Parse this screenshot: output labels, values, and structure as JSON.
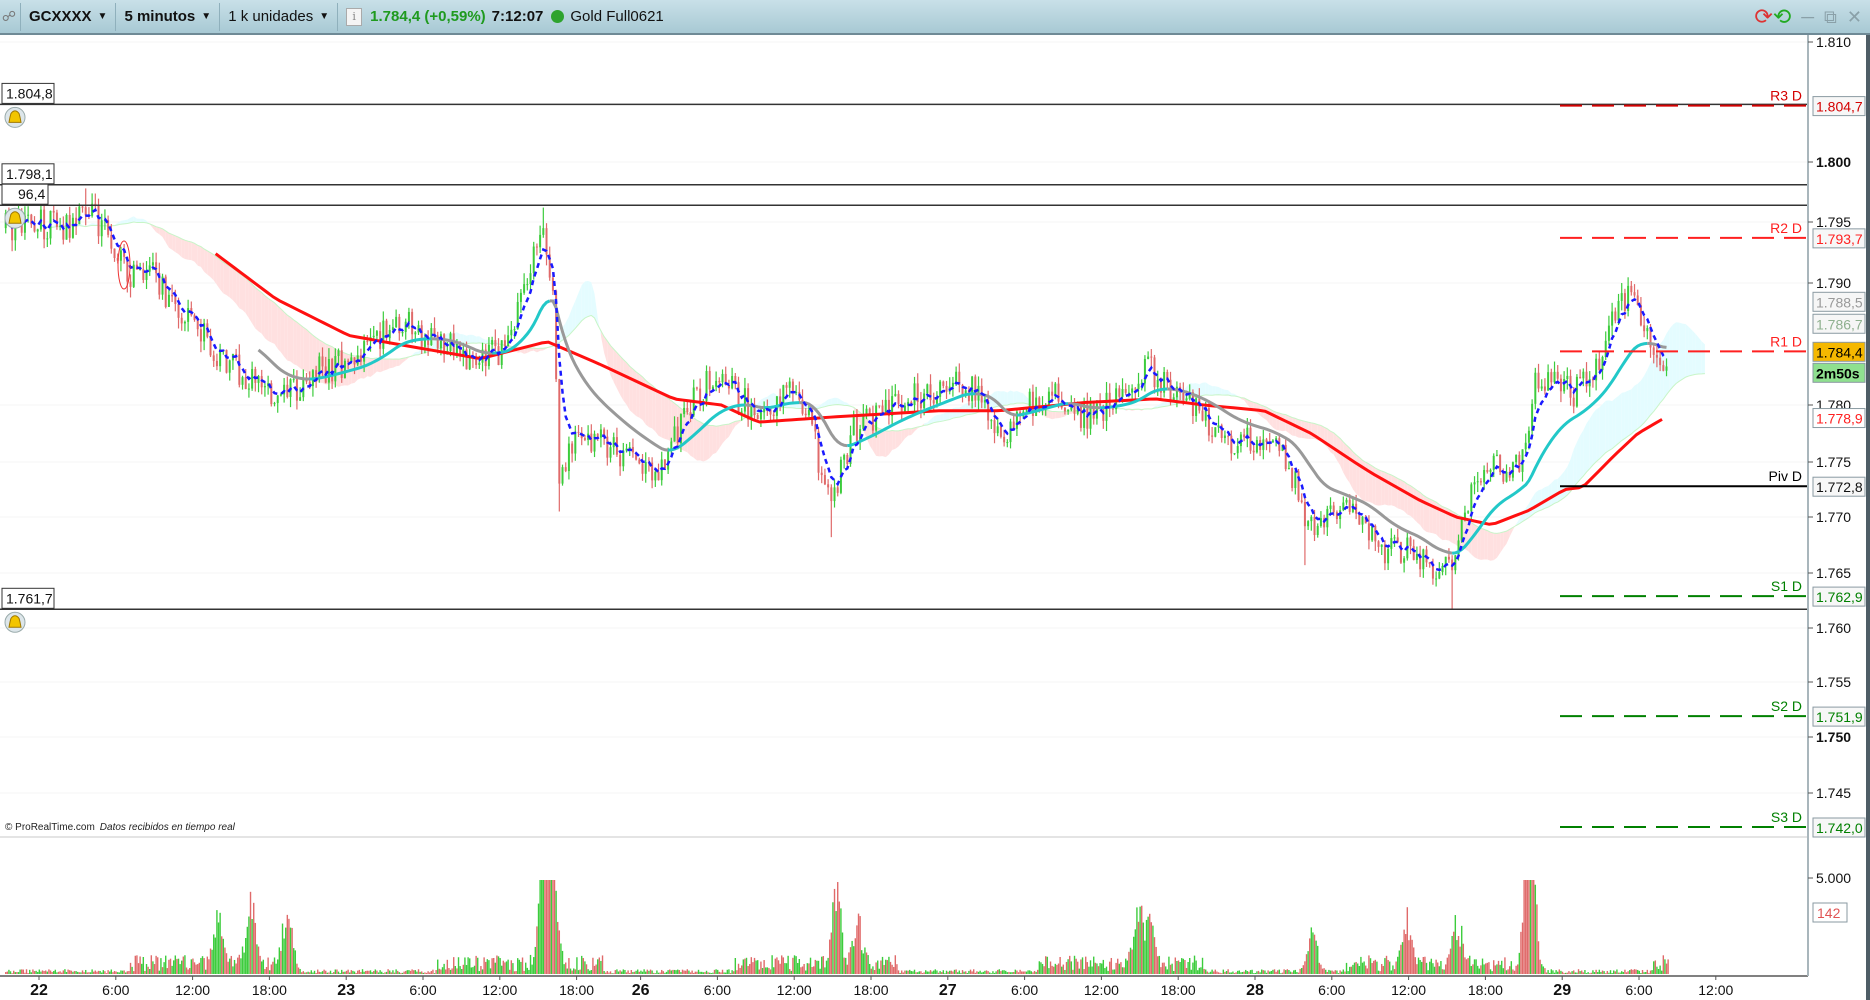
{
  "toolbar": {
    "symbol": "GCXXXX",
    "timeframe": "5 minutos",
    "units": "1 k unidades",
    "last_price": "1.784,4 (+0,59%)",
    "time": "7:12:07",
    "instrument_name": "Gold Full0621",
    "status_color": "#2ea32e"
  },
  "footer": {
    "copyright": "© ProRealTime.com",
    "realtime_note": "Datos recibidos en tiempo real"
  },
  "alerts": [
    {
      "label": "1.804,8",
      "price": 1.8048,
      "bell": true
    },
    {
      "label": "1.798,1",
      "price": 1.7981,
      "bell": false
    },
    {
      "label": "96,4",
      "price": 1.7964,
      "bell": true
    },
    {
      "label": "1.761,7",
      "price": 1.7617,
      "bell": true
    }
  ],
  "pivots": [
    {
      "name": "R3 D",
      "value": "1.804,7",
      "price": 1.8047,
      "color": "#d40000",
      "style": "dashed"
    },
    {
      "name": "R2 D",
      "value": "1.793,7",
      "price": 1.7937,
      "color": "#ff2020",
      "style": "dashed"
    },
    {
      "name": "R1 D",
      "value": "1.784,4",
      "price": 1.7844,
      "color": "#ff2020",
      "style": "dashed",
      "hide_box": true
    },
    {
      "name": "Piv D",
      "value": "1.772,8",
      "price": 1.7728,
      "color": "#000000",
      "style": "solid"
    },
    {
      "name": "S1 D",
      "value": "1.762,9",
      "price": 1.7629,
      "color": "#008000",
      "style": "dashed"
    },
    {
      "name": "S2 D",
      "value": "1.751,9",
      "price": 1.7519,
      "color": "#008000",
      "style": "dashed"
    },
    {
      "name": "S3 D",
      "value": "1.742,0",
      "price": 1.742,
      "color": "#008000",
      "style": "dashed"
    }
  ],
  "price_boxes": [
    {
      "label": "1.788,5",
      "price": 1.7885,
      "color": "#999999",
      "bg": "#f6f6f6"
    },
    {
      "label": "1.786,7",
      "price": 1.7867,
      "color": "#8fb08f",
      "bg": "#f6f6f6"
    },
    {
      "label": "1.784,4",
      "price": 1.7844,
      "color": "#000000",
      "bg": "#f5b800"
    },
    {
      "label": "2m50s",
      "price": 1.783,
      "color": "#000000",
      "bg": "#8fe08f",
      "bold": true
    },
    {
      "label": "1.778,9",
      "price": 1.7789,
      "color": "#ff2020",
      "bg": "#ffffff"
    }
  ],
  "chart_data": {
    "type": "candlestick",
    "symbol": "GCXXXX",
    "interval": "5 minutos",
    "y_ticks": [
      {
        "value": 1.81,
        "label": "1.810"
      },
      {
        "value": 1.8,
        "label": "1.800",
        "bold": true
      },
      {
        "value": 1.795,
        "label": "1.795"
      },
      {
        "value": 1.79,
        "label": "1.790"
      },
      {
        "value": 1.78,
        "label": "1.780"
      },
      {
        "value": 1.775,
        "label": "1.775"
      },
      {
        "value": 1.77,
        "label": "1.770"
      },
      {
        "value": 1.765,
        "label": "1.765"
      },
      {
        "value": 1.76,
        "label": "1.760"
      },
      {
        "value": 1.755,
        "label": "1.755"
      },
      {
        "value": 1.75,
        "label": "1.750",
        "bold": true
      },
      {
        "value": 1.745,
        "label": "1.745"
      }
    ],
    "x_ticks": [
      {
        "t": 0,
        "label": "22",
        "bold": true
      },
      {
        "t": 6,
        "label": "6:00"
      },
      {
        "t": 12,
        "label": "12:00"
      },
      {
        "t": 18,
        "label": "18:00"
      },
      {
        "t": 24,
        "label": "23",
        "bold": true
      },
      {
        "t": 30,
        "label": "6:00"
      },
      {
        "t": 36,
        "label": "12:00"
      },
      {
        "t": 42,
        "label": "18:00"
      },
      {
        "t": 47,
        "label": "26",
        "bold": true
      },
      {
        "t": 53,
        "label": "6:00"
      },
      {
        "t": 59,
        "label": "12:00"
      },
      {
        "t": 65,
        "label": "18:00"
      },
      {
        "t": 71,
        "label": "27",
        "bold": true
      },
      {
        "t": 77,
        "label": "6:00"
      },
      {
        "t": 83,
        "label": "12:00"
      },
      {
        "t": 89,
        "label": "18:00"
      },
      {
        "t": 95,
        "label": "28",
        "bold": true
      },
      {
        "t": 101,
        "label": "6:00"
      },
      {
        "t": 107,
        "label": "12:00"
      },
      {
        "t": 113,
        "label": "18:00"
      },
      {
        "t": 119,
        "label": "29",
        "bold": true
      },
      {
        "t": 125,
        "label": "6:00"
      },
      {
        "t": 131,
        "label": "12:00"
      }
    ],
    "day_starts": [
      0,
      24,
      47,
      71,
      95,
      119
    ],
    "price_path": [
      [
        -2.6,
        1.7945
      ],
      [
        -0.3,
        1.795
      ],
      [
        2.5,
        1.7945
      ],
      [
        3.7,
        1.7965
      ],
      [
        5.4,
        1.794
      ],
      [
        6.8,
        1.791
      ],
      [
        9.1,
        1.7905
      ],
      [
        11.5,
        1.787
      ],
      [
        13.4,
        1.785
      ],
      [
        15.2,
        1.783
      ],
      [
        17.1,
        1.782
      ],
      [
        18.5,
        1.78
      ],
      [
        20.4,
        1.7815
      ],
      [
        22.3,
        1.783
      ],
      [
        25.1,
        1.784
      ],
      [
        27.9,
        1.787
      ],
      [
        29.4,
        1.786
      ],
      [
        31.7,
        1.785
      ],
      [
        34.1,
        1.783
      ],
      [
        36.4,
        1.785
      ],
      [
        38.3,
        1.79
      ],
      [
        39.2,
        1.795
      ],
      [
        40.2,
        1.788
      ],
      [
        40.6,
        1.774
      ],
      [
        42.1,
        1.777
      ],
      [
        43.9,
        1.777
      ],
      [
        45.8,
        1.7755
      ],
      [
        48.6,
        1.774
      ],
      [
        50.5,
        1.7795
      ],
      [
        52.4,
        1.782
      ],
      [
        54.3,
        1.781
      ],
      [
        56.2,
        1.779
      ],
      [
        58.0,
        1.781
      ],
      [
        59.9,
        1.78
      ],
      [
        61.8,
        1.771
      ],
      [
        63.7,
        1.778
      ],
      [
        66.5,
        1.78
      ],
      [
        69.3,
        1.781
      ],
      [
        72.2,
        1.782
      ],
      [
        74.0,
        1.78
      ],
      [
        75.4,
        1.776
      ],
      [
        76.9,
        1.78
      ],
      [
        79.7,
        1.781
      ],
      [
        81.6,
        1.779
      ],
      [
        83.4,
        1.78
      ],
      [
        85.3,
        1.781
      ],
      [
        86.7,
        1.783
      ],
      [
        88.6,
        1.781
      ],
      [
        91.0,
        1.779
      ],
      [
        92.9,
        1.777
      ],
      [
        95.7,
        1.777
      ],
      [
        97.6,
        1.775
      ],
      [
        99.0,
        1.77
      ],
      [
        99.9,
        1.7685
      ],
      [
        101.3,
        1.771
      ],
      [
        103.2,
        1.77
      ],
      [
        105.1,
        1.767
      ],
      [
        107.4,
        1.767
      ],
      [
        108.8,
        1.765
      ],
      [
        110.4,
        1.766
      ],
      [
        111.7,
        1.772
      ],
      [
        113.1,
        1.775
      ],
      [
        114.9,
        1.774
      ],
      [
        116.2,
        1.776
      ],
      [
        116.8,
        1.782
      ],
      [
        118.7,
        1.782
      ],
      [
        120.1,
        1.781
      ],
      [
        122.0,
        1.784
      ],
      [
        123.4,
        1.788
      ],
      [
        124.4,
        1.789
      ],
      [
        125.3,
        1.786
      ],
      [
        126.7,
        1.7835
      ],
      [
        127.2,
        1.7844
      ]
    ],
    "extremes": [
      {
        "t": 3.7,
        "high": 1.7978
      },
      {
        "t": 39.3,
        "high": 1.7962
      },
      {
        "t": 40.7,
        "low": 1.7705
      },
      {
        "t": 62.0,
        "low": 1.7682
      },
      {
        "t": 110.5,
        "low": 1.7617
      },
      {
        "t": 123.6,
        "high": 1.79
      },
      {
        "t": 98.8,
        "low": 1.7657
      }
    ],
    "moving_average_long": [
      [
        13.8,
        1.7924
      ],
      [
        18.5,
        1.7887
      ],
      [
        24.2,
        1.7857
      ],
      [
        27.9,
        1.785
      ],
      [
        34.5,
        1.7838
      ],
      [
        39.7,
        1.7852
      ],
      [
        43.9,
        1.7833
      ],
      [
        49.6,
        1.7805
      ],
      [
        53.3,
        1.78
      ],
      [
        56.2,
        1.7785
      ],
      [
        62.7,
        1.779
      ],
      [
        70.3,
        1.7795
      ],
      [
        75.0,
        1.7795
      ],
      [
        81.6,
        1.7802
      ],
      [
        87.2,
        1.7805
      ],
      [
        91.0,
        1.78
      ],
      [
        95.7,
        1.7795
      ],
      [
        99.4,
        1.7775
      ],
      [
        104.1,
        1.774
      ],
      [
        107.9,
        1.7715
      ],
      [
        110.7,
        1.77
      ],
      [
        113.5,
        1.7693
      ],
      [
        116.4,
        1.7706
      ],
      [
        119.2,
        1.7725
      ],
      [
        120.6,
        1.7727
      ],
      [
        123.0,
        1.7755
      ],
      [
        124.9,
        1.7775
      ],
      [
        127.2,
        1.779
      ]
    ],
    "volume_axis": {
      "label": "5.000",
      "value": 5000
    },
    "current_volume": "142",
    "volume_spikes": [
      {
        "t": 14.0,
        "v": 3100
      },
      {
        "t": 16.6,
        "v": 3900
      },
      {
        "t": 19.4,
        "v": 3600
      },
      {
        "t": 39.4,
        "v": 7000
      },
      {
        "t": 40.1,
        "v": 6200
      },
      {
        "t": 62.3,
        "v": 4900
      },
      {
        "t": 64.0,
        "v": 2600
      },
      {
        "t": 85.9,
        "v": 3600
      },
      {
        "t": 86.8,
        "v": 2900
      },
      {
        "t": 99.5,
        "v": 2600
      },
      {
        "t": 106.9,
        "v": 2800
      },
      {
        "t": 110.8,
        "v": 2700
      },
      {
        "t": 116.6,
        "v": 7300
      },
      {
        "t": 116.2,
        "v": 3800
      }
    ],
    "legend": "none"
  }
}
